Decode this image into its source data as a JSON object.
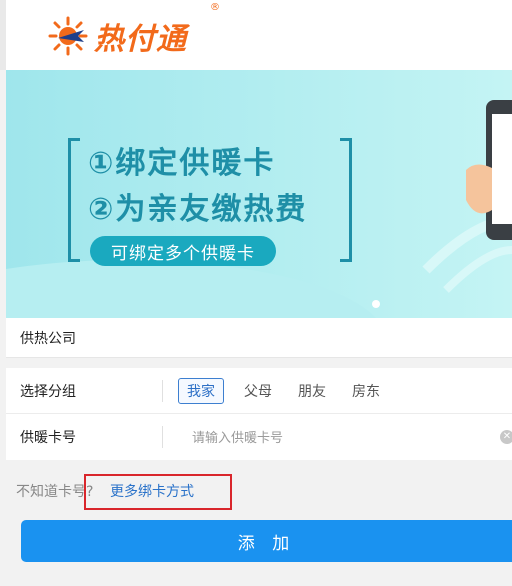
{
  "brand": {
    "name": "热付通",
    "registered_mark": "®",
    "orange": "#f26a1b"
  },
  "banner": {
    "line1": "①绑定供暖卡",
    "line2": "②为亲友缴热费",
    "pill": "可绑定多个供暖卡",
    "bg": "#a6e9ee"
  },
  "form": {
    "company_label": "供热公司",
    "group_label": "选择分组",
    "groups": [
      "我家",
      "父母",
      "朋友",
      "房东"
    ],
    "selected_group": "我家",
    "card_label": "供暖卡号",
    "card_placeholder": "请输入供暖卡号",
    "card_value": ""
  },
  "footer": {
    "hint": "不知道卡号?",
    "more_link": "更多绑卡方式",
    "add_button": "添 加",
    "accent": "#1a92f0"
  },
  "icons": {
    "logo": "sun-plane-logo-icon",
    "clear": "clear-circle-icon"
  }
}
